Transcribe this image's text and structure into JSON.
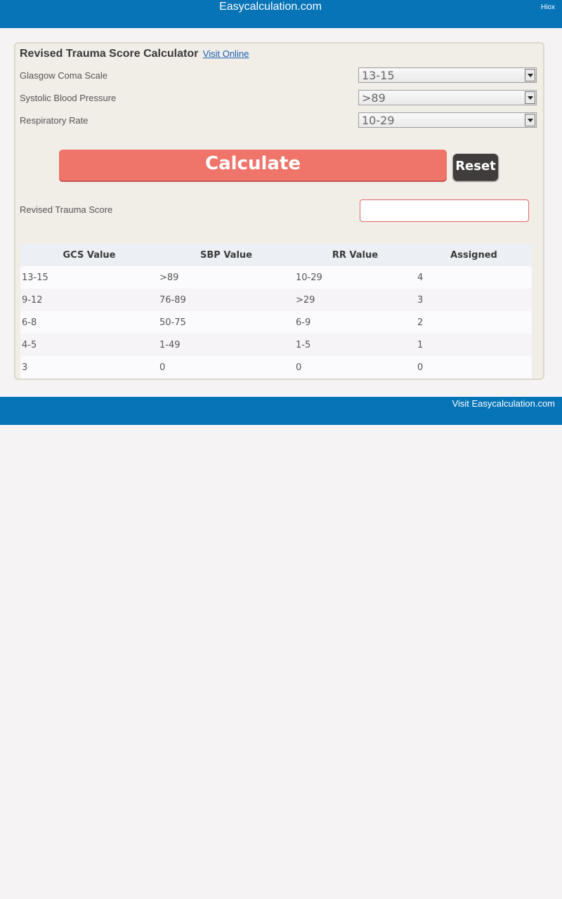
{
  "header": {
    "site_title": "Easycalculation.com",
    "corner_link": "Hiox"
  },
  "calculator": {
    "title": "Revised Trauma Score Calculator",
    "visit_link": "Visit Online",
    "fields": [
      {
        "label": "Glasgow Coma Scale",
        "value": "13-15"
      },
      {
        "label": "Systolic Blood Pressure",
        "value": ">89"
      },
      {
        "label": "Respiratory Rate",
        "value": "10-29"
      }
    ],
    "calculate_label": "Calculate",
    "reset_label": "Reset",
    "result_label": "Revised Trauma Score",
    "result_value": ""
  },
  "table": {
    "headers": [
      "GCS Value",
      "SBP Value",
      "RR Value",
      "Assigned"
    ],
    "rows": [
      [
        "13-15",
        ">89",
        "10-29",
        "4"
      ],
      [
        "9-12",
        "76-89",
        ">29",
        "3"
      ],
      [
        "6-8",
        "50-75",
        "6-9",
        "2"
      ],
      [
        "4-5",
        "1-49",
        "1-5",
        "1"
      ],
      [
        "3",
        "0",
        "0",
        "0"
      ]
    ]
  },
  "footer": {
    "visit_label": "Visit Easycalculation.com"
  }
}
